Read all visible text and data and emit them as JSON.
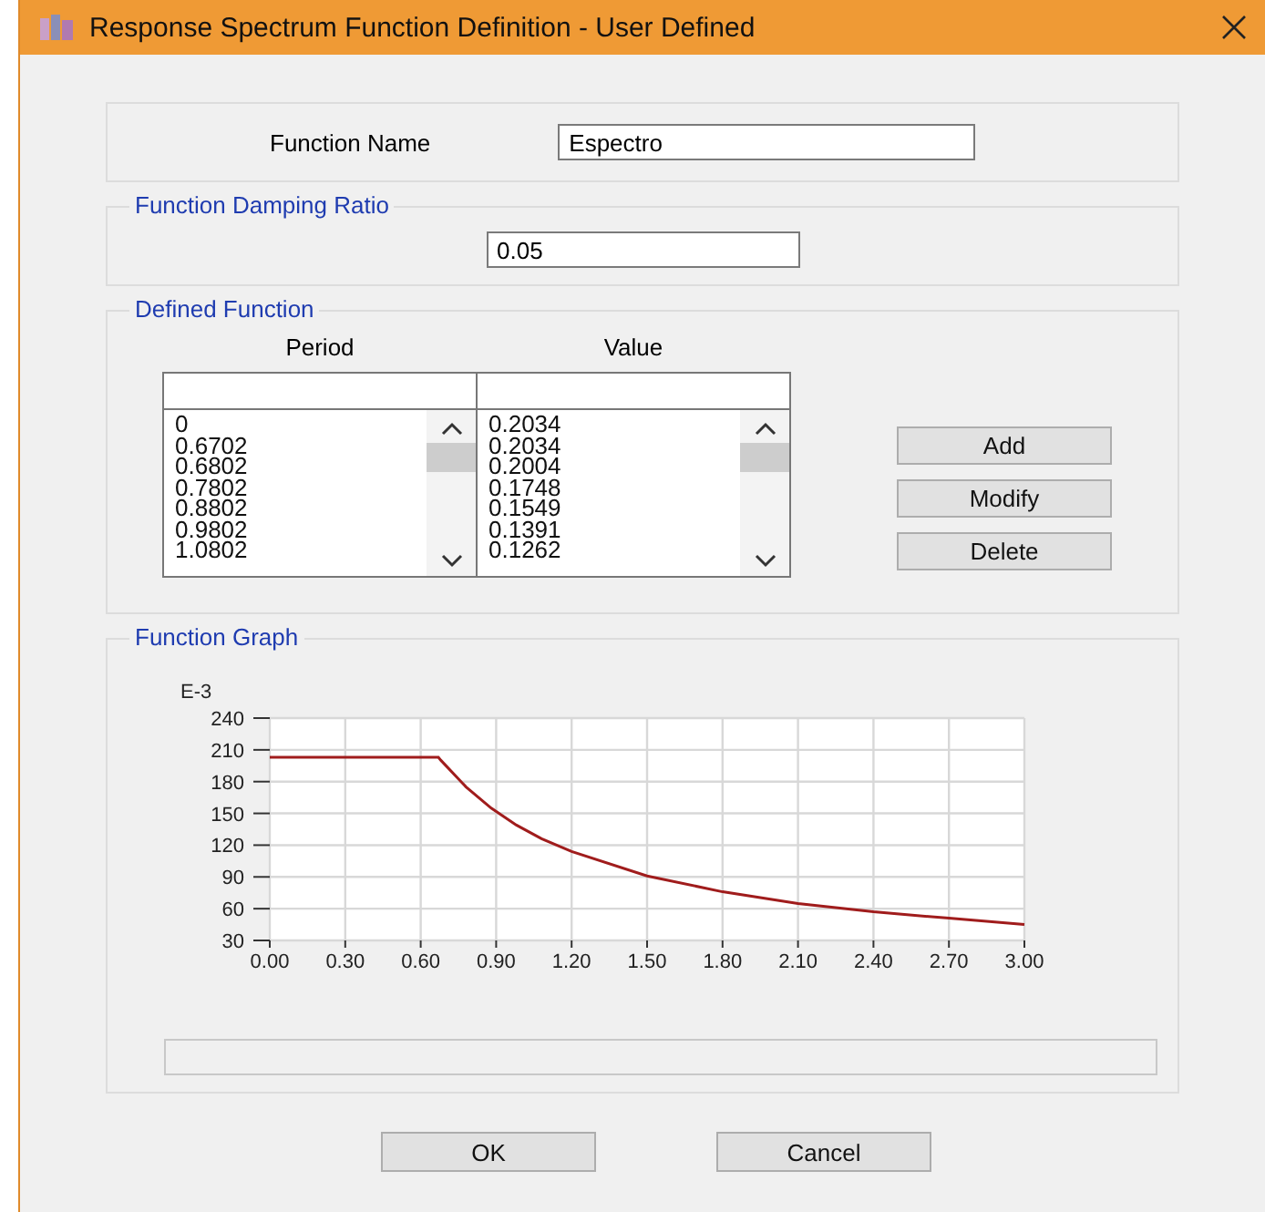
{
  "window": {
    "title": "Response Spectrum Function Definition - User Defined"
  },
  "function_name": {
    "label": "Function Name",
    "value": "Espectro"
  },
  "damping": {
    "title": "Function Damping Ratio",
    "value": "0.05"
  },
  "defined_function": {
    "title": "Defined Function",
    "columns": [
      "Period",
      "Value"
    ],
    "period": [
      "0",
      "0.6702",
      "0.6802",
      "0.7802",
      "0.8802",
      "0.9802",
      "1.0802"
    ],
    "value": [
      "0.2034",
      "0.2034",
      "0.2004",
      "0.1748",
      "0.1549",
      "0.1391",
      "0.1262"
    ],
    "buttons": [
      "Add",
      "Modify",
      "Delete"
    ]
  },
  "graph": {
    "title": "Function Graph",
    "chart_data": {
      "type": "line",
      "ylabel": "E-3",
      "x": [
        0,
        0.6702,
        0.6802,
        0.7802,
        0.8802,
        0.9802,
        1.0802,
        1.2,
        1.5,
        1.8,
        2.1,
        2.4,
        2.7,
        3.0
      ],
      "series": [
        {
          "color": "#a01c1c",
          "values": [
            203,
            203,
            200,
            175,
            155,
            139,
            126,
            114,
            91,
            76,
            65,
            57,
            51,
            45
          ]
        }
      ],
      "grid": true,
      "xlim": [
        0,
        3
      ],
      "ylim": [
        30,
        240
      ],
      "xticks": [
        {
          "value": 0,
          "label": "0.00"
        },
        {
          "value": 0.3,
          "label": "0.30"
        },
        {
          "value": 0.6,
          "label": "0.60"
        },
        {
          "value": 0.9,
          "label": "0.90"
        },
        {
          "value": 1.2,
          "label": "1.20"
        },
        {
          "value": 1.5,
          "label": "1.50"
        },
        {
          "value": 1.8,
          "label": "1.80"
        },
        {
          "value": 2.1,
          "label": "2.10"
        },
        {
          "value": 2.4,
          "label": "2.40"
        },
        {
          "value": 2.7,
          "label": "2.70"
        },
        {
          "value": 3.0,
          "label": "3.00"
        }
      ],
      "yticks": [
        30,
        60,
        90,
        120,
        150,
        180,
        210,
        240
      ]
    }
  },
  "buttons": [
    "OK",
    "Cancel"
  ]
}
